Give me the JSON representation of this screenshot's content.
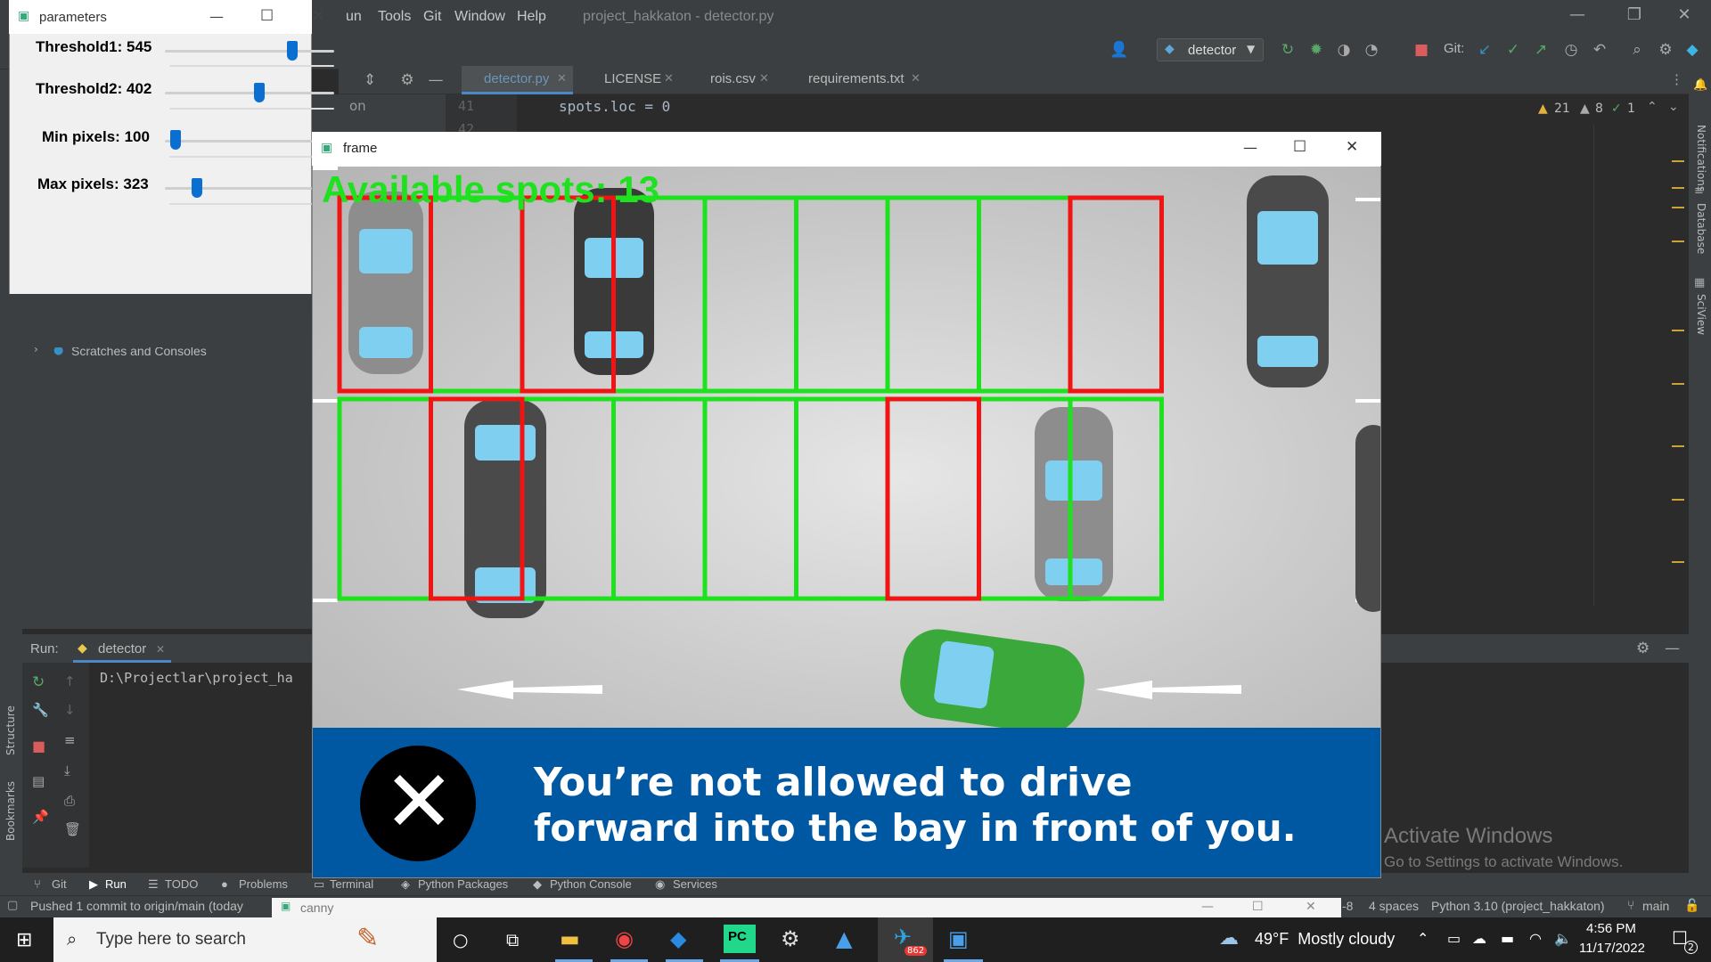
{
  "ide": {
    "menu": [
      "un",
      "Tools",
      "Git",
      "Window",
      "Help"
    ],
    "title": "project_hakkaton - detector.py",
    "run_config": "detector",
    "git_label": "Git:",
    "tabs": [
      "detector.py",
      "LICENSE",
      "rois.csv",
      "requirements.txt"
    ],
    "line_numbers": [
      "41",
      "42"
    ],
    "code_line": "spots.loc = 0",
    "inspections": {
      "warnings": "21",
      "weak": "8",
      "ok": "1"
    },
    "project_tree_item": "Scratches and Consoles",
    "partial_label": "on",
    "right_labels": [
      "Notifications",
      "Database",
      "SciView"
    ],
    "left_labels": [
      "Structure",
      "Bookmarks"
    ]
  },
  "run_panel": {
    "label": "Run:",
    "tab": "detector",
    "output": "D:\\Projectlar\\project_ha"
  },
  "bottom_tools": [
    "Git",
    "Run",
    "TODO",
    "Problems",
    "Terminal",
    "Python Packages",
    "Python Console",
    "Services"
  ],
  "statusbar": {
    "message": "Pushed 1 commit to origin/main (today",
    "encoding": "-8",
    "indent": "4 spaces",
    "interpreter": "Python 3.10 (project_hakkaton)",
    "branch": "main"
  },
  "activation": {
    "title": "Activate Windows",
    "subtitle": "Go to Settings to activate Windows."
  },
  "params_window": {
    "title": "parameters",
    "sliders": [
      {
        "label": "Threshold1: 545",
        "fraction": 0.75
      },
      {
        "label": "Threshold2: 402",
        "fraction": 0.56
      },
      {
        "label": "Min pixels: 100",
        "fraction": 0.07
      },
      {
        "label": "Max pixels: 323",
        "fraction": 0.22
      }
    ]
  },
  "frame_window": {
    "title": "frame",
    "available_text": "Available spots: 13",
    "banner_line1": "You’re not allowed to drive",
    "banner_line2": "forward into the bay in front of you.",
    "spots_row1": [
      "occupied",
      "free",
      "occupied",
      "free",
      "free",
      "free",
      "free",
      "free",
      "occupied"
    ],
    "spots_row2": [
      "free",
      "occupied",
      "free",
      "free",
      "free",
      "free",
      "occupied",
      "free",
      "free"
    ]
  },
  "canny_window": {
    "title": "canny"
  },
  "taskbar": {
    "search_placeholder": "Type here to search",
    "weather": "49°F  Mostly cloudy",
    "time": "4:56 PM",
    "date": "11/17/2022",
    "telegram_badge": "862",
    "notif_count": "2"
  },
  "colors": {
    "free": "#1ee21e",
    "occupied": "#f01414",
    "banner": "#0058a3"
  }
}
